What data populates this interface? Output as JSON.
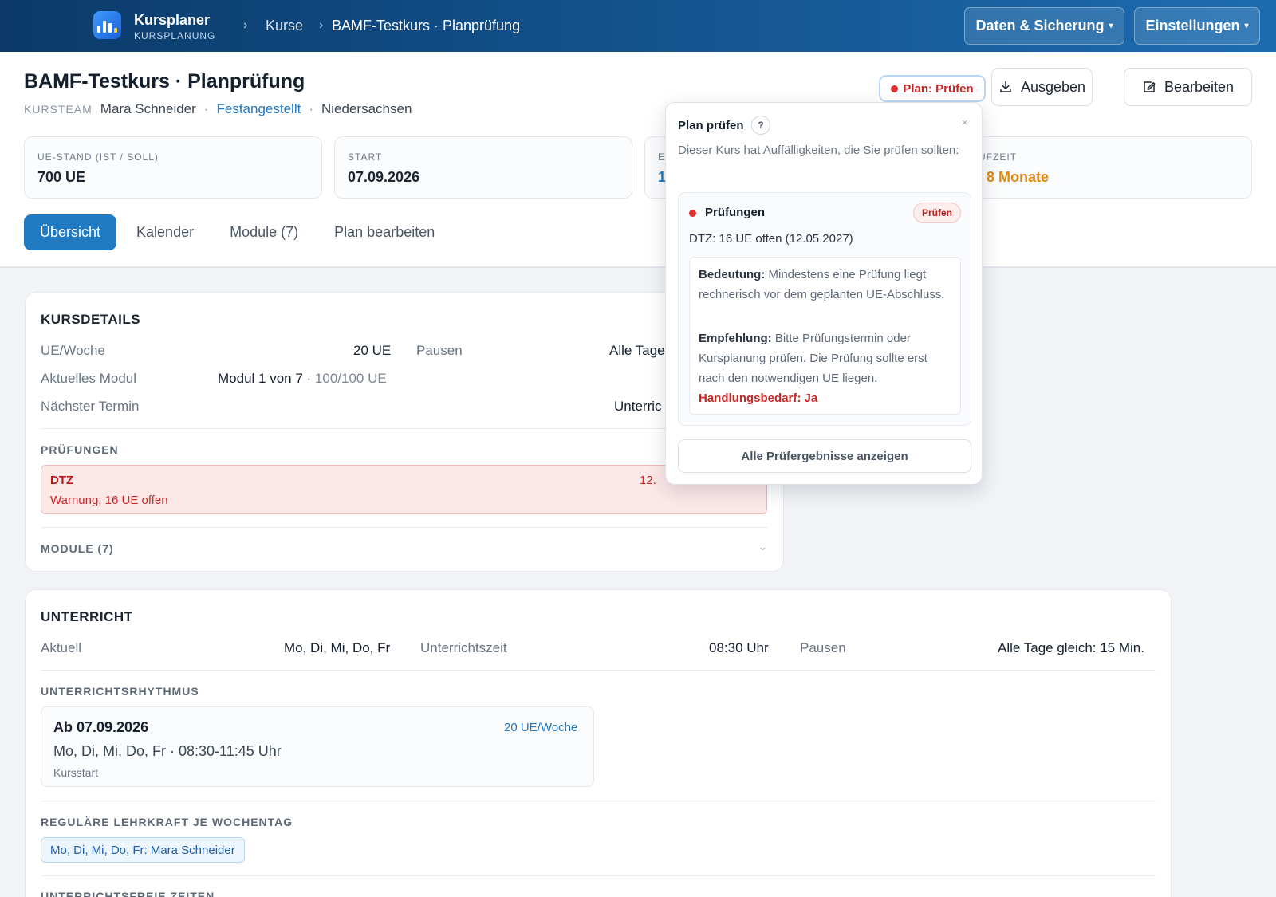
{
  "app": {
    "name": "Kursplaner",
    "subtitle": "KURSPLANUNG"
  },
  "breadcrumb": {
    "items": [
      "Kurse",
      "BAMF-Testkurs · Planprüfung"
    ]
  },
  "topbar": {
    "data_label": "Daten & Sicherung",
    "settings_label": "Einstellungen",
    "caret": "▾"
  },
  "page": {
    "title": "BAMF-Testkurs · Planprüfung",
    "team_label": "KURSTEAM",
    "team_name": "Mara Schneider",
    "employment": "Festangestellt",
    "state": "Niedersachsen",
    "sep": "·"
  },
  "actions": {
    "status": "Plan: Prüfen",
    "export": "Ausgeben",
    "edit": "Bearbeiten"
  },
  "stats": [
    {
      "label": "UE-STAND (IST / SOLL)",
      "value": "700 UE"
    },
    {
      "label": "START",
      "value": "07.09.2026"
    },
    {
      "label": "E",
      "value": "1"
    },
    {
      "label": "UFZEIT",
      "value": ". 8 Monate"
    }
  ],
  "tabs": [
    "Übersicht",
    "Kalender",
    "Module (7)",
    "Plan bearbeiten"
  ],
  "details": {
    "title": "KURSDETAILS",
    "ue_week_label": "UE/Woche",
    "ue_week_value": "20 UE",
    "pauses_label": "Pausen",
    "pauses_value": "Alle Tage",
    "module_label": "Aktuelles Modul",
    "module_value": "Modul 1 von 7",
    "module_progress": "· 100/100 UE",
    "next_label": "Nächster Termin",
    "next_value": "Unterric",
    "exams_title": "PRÜFUNGEN",
    "exam_name": "DTZ",
    "exam_warning": "Warnung: 16 UE offen",
    "exam_date": "12.",
    "modules_title": "MODULE (7)",
    "modules_chevron": "⌄"
  },
  "teaching": {
    "title": "UNTERRICHT",
    "current_label": "Aktuell",
    "current_value": "Mo, Di, Mi, Do, Fr",
    "time_label": "Unterrichtszeit",
    "time_value": "08:30 Uhr",
    "pauses_label": "Pausen",
    "pauses_value": "Alle Tage gleich: 15 Min.",
    "rhythm_title": "UNTERRICHTSRHYTHMUS",
    "rhythm_from": "Ab 07.09.2026",
    "rhythm_rate": "20 UE/Woche",
    "rhythm_days": "Mo, Di, Mi, Do, Fr · 08:30-11:45 Uhr",
    "rhythm_note": "Kursstart",
    "teacher_title": "REGULÄRE LEHRKRAFT JE WOCHENTAG",
    "teacher_chip": "Mo, Di, Mi, Do, Fr: Mara Schneider",
    "free_title": "UNTERRICHTSFREIE ZEITEN"
  },
  "popover": {
    "title": "Plan prüfen",
    "help": "?",
    "close": "×",
    "description": "Dieser Kurs hat Auffälligkeiten, die Sie prüfen sollten:",
    "item_title": "Prüfungen",
    "item_badge": "Prüfen",
    "item_line": "DTZ: 16 UE offen (12.05.2027)",
    "meaning_label": "Bedeutung:",
    "meaning_text": " Mindestens eine Prüfung liegt rechnerisch vor dem geplanten UE-Abschluss.",
    "rec_label": "Empfehlung:",
    "rec_text": " Bitte Prüfungstermin oder Kursplanung prüfen. Die Prüfung sollte erst nach den notwendigen UE liegen.",
    "action_needed": "Handlungsbedarf: Ja",
    "all_results": "Alle Prüfergebnisse anzeigen"
  },
  "colors": {
    "accent": "#1f7ac2",
    "danger": "#c62828",
    "warning": "#e08a12"
  }
}
